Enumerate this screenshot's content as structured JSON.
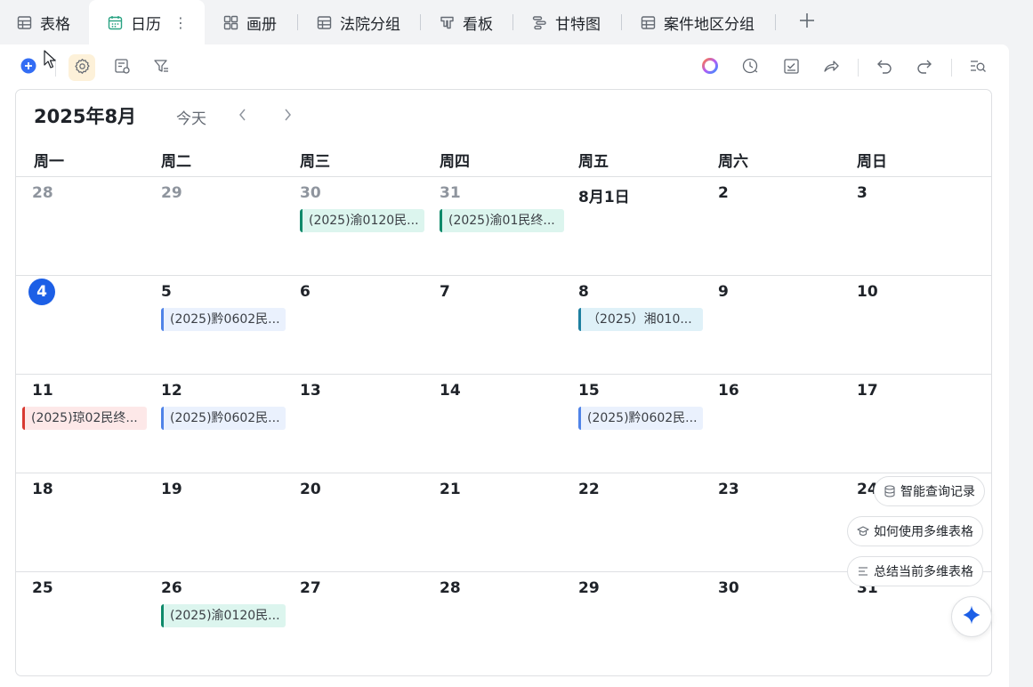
{
  "tabs": [
    {
      "label": "表格",
      "icon": "grid-table-icon"
    },
    {
      "label": "日历",
      "icon": "calendar-icon",
      "active": true
    },
    {
      "label": "画册",
      "icon": "gallery-icon"
    },
    {
      "label": "法院分组",
      "icon": "grid-table-icon"
    },
    {
      "label": "看板",
      "icon": "kanban-icon"
    },
    {
      "label": "甘特图",
      "icon": "gantt-icon"
    },
    {
      "label": "案件地区分组",
      "icon": "grid-table-icon"
    }
  ],
  "tab_more": "⋮",
  "toolbar_left": [
    "add-record-icon",
    "settings-icon",
    "record-list-icon",
    "filter-icon"
  ],
  "toolbar_right": [
    "ai-orb-icon",
    "history-icon",
    "task-check-icon",
    "share-icon",
    "undo-icon",
    "redo-icon",
    "search-icon"
  ],
  "calendar": {
    "title": "2025年8月",
    "today_label": "今天",
    "weekdays": [
      "周一",
      "周二",
      "周三",
      "周四",
      "周五",
      "周六",
      "周日"
    ],
    "weeks": [
      [
        {
          "label": "28",
          "muted": true
        },
        {
          "label": "29",
          "muted": true
        },
        {
          "label": "30",
          "muted": true,
          "events": [
            {
              "text": "(2025)渝0120民...",
              "color": "teal"
            }
          ]
        },
        {
          "label": "31",
          "muted": true,
          "events": [
            {
              "text": "(2025)渝01民终...",
              "color": "teal"
            }
          ]
        },
        {
          "label": "8月1日"
        },
        {
          "label": "2"
        },
        {
          "label": "3"
        }
      ],
      [
        {
          "label": "4",
          "today": true
        },
        {
          "label": "5",
          "events": [
            {
              "text": "(2025)黔0602民...",
              "color": "blue"
            }
          ]
        },
        {
          "label": "6"
        },
        {
          "label": "7"
        },
        {
          "label": "8",
          "events": [
            {
              "text": "（2025）湘010...",
              "color": "cyan"
            }
          ]
        },
        {
          "label": "9"
        },
        {
          "label": "10"
        }
      ],
      [
        {
          "label": "11",
          "events": [
            {
              "text": "(2025)琼02民终...",
              "color": "red",
              "shift": true
            }
          ]
        },
        {
          "label": "12",
          "events": [
            {
              "text": "(2025)黔0602民...",
              "color": "blue"
            }
          ]
        },
        {
          "label": "13"
        },
        {
          "label": "14"
        },
        {
          "label": "15",
          "events": [
            {
              "text": "(2025)黔0602民...",
              "color": "blue"
            }
          ]
        },
        {
          "label": "16"
        },
        {
          "label": "17"
        }
      ],
      [
        {
          "label": "18"
        },
        {
          "label": "19"
        },
        {
          "label": "20"
        },
        {
          "label": "21"
        },
        {
          "label": "22"
        },
        {
          "label": "23"
        },
        {
          "label": "24"
        }
      ],
      [
        {
          "label": "25"
        },
        {
          "label": "26",
          "events": [
            {
              "text": "(2025)渝0120民...",
              "color": "teal"
            }
          ]
        },
        {
          "label": "27"
        },
        {
          "label": "28"
        },
        {
          "label": "29"
        },
        {
          "label": "30"
        },
        {
          "label": "31"
        }
      ]
    ]
  },
  "ai_suggestions": [
    {
      "label": "智能查询记录",
      "icon": "database-icon"
    },
    {
      "label": "如何使用多维表格",
      "icon": "graduation-cap-icon"
    },
    {
      "label": "总结当前多维表格",
      "icon": "list-summary-icon"
    }
  ],
  "colors": {
    "accent": "#1c5fe6",
    "teal": "#0e8a6a",
    "blue": "#4f83e8",
    "cyan": "#1e7fa0",
    "red": "#d83931"
  }
}
